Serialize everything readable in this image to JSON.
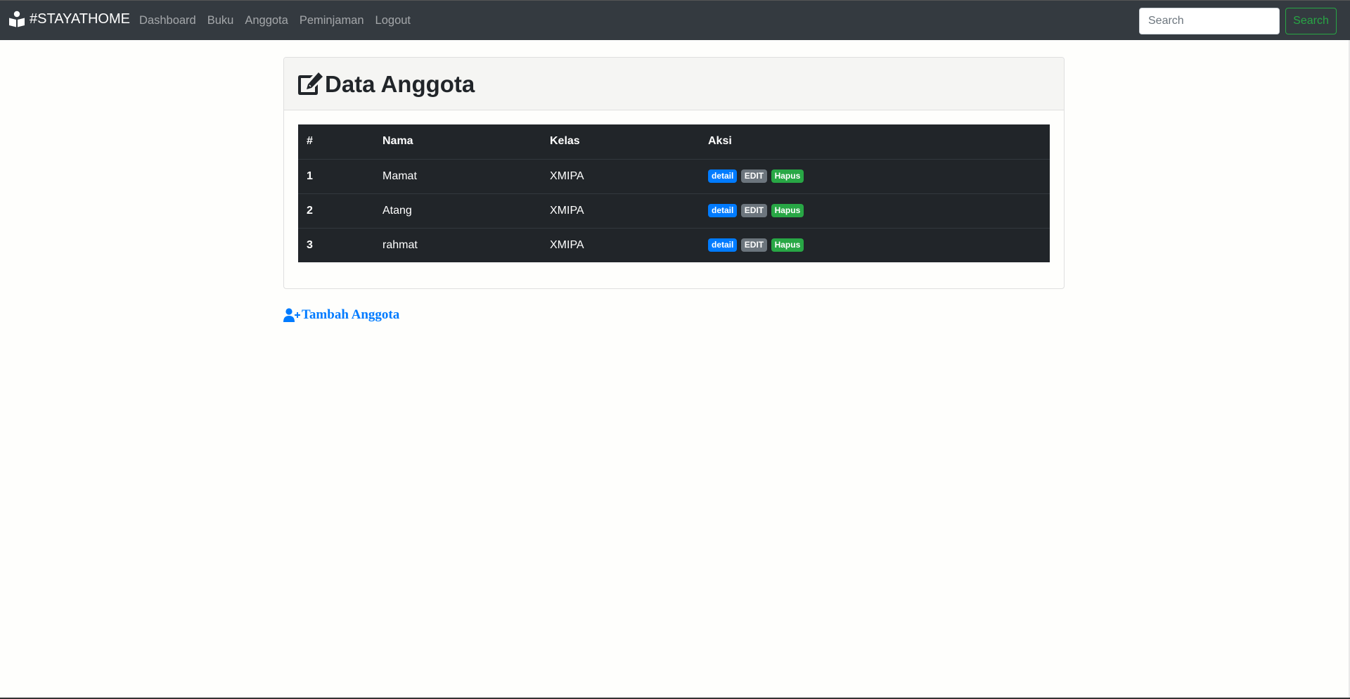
{
  "navbar": {
    "brand": "#STAYATHOME",
    "links": [
      "Dashboard",
      "Buku",
      "Anggota",
      "Peminjaman",
      "Logout"
    ],
    "search_placeholder": "Search",
    "search_button": "Search"
  },
  "card": {
    "title": "Data Anggota",
    "table": {
      "headers": [
        "#",
        "Nama",
        "Kelas",
        "Aksi"
      ],
      "rows": [
        {
          "num": "1",
          "nama": "Mamat",
          "kelas": "XMIPA"
        },
        {
          "num": "2",
          "nama": "Atang",
          "kelas": "XMIPA"
        },
        {
          "num": "3",
          "nama": "rahmat",
          "kelas": "XMIPA"
        }
      ],
      "actions": {
        "detail": "detail",
        "edit": "EDIT",
        "hapus": "Hapus"
      }
    }
  },
  "add_member_link": "Tambah Anggota",
  "colors": {
    "navbar_bg": "#343a40",
    "table_bg": "#212529",
    "primary": "#007bff",
    "secondary": "#6c757d",
    "success": "#28a745"
  },
  "icons": {
    "brand": "book-reader-icon",
    "title": "edit-icon",
    "add": "user-plus-icon"
  }
}
